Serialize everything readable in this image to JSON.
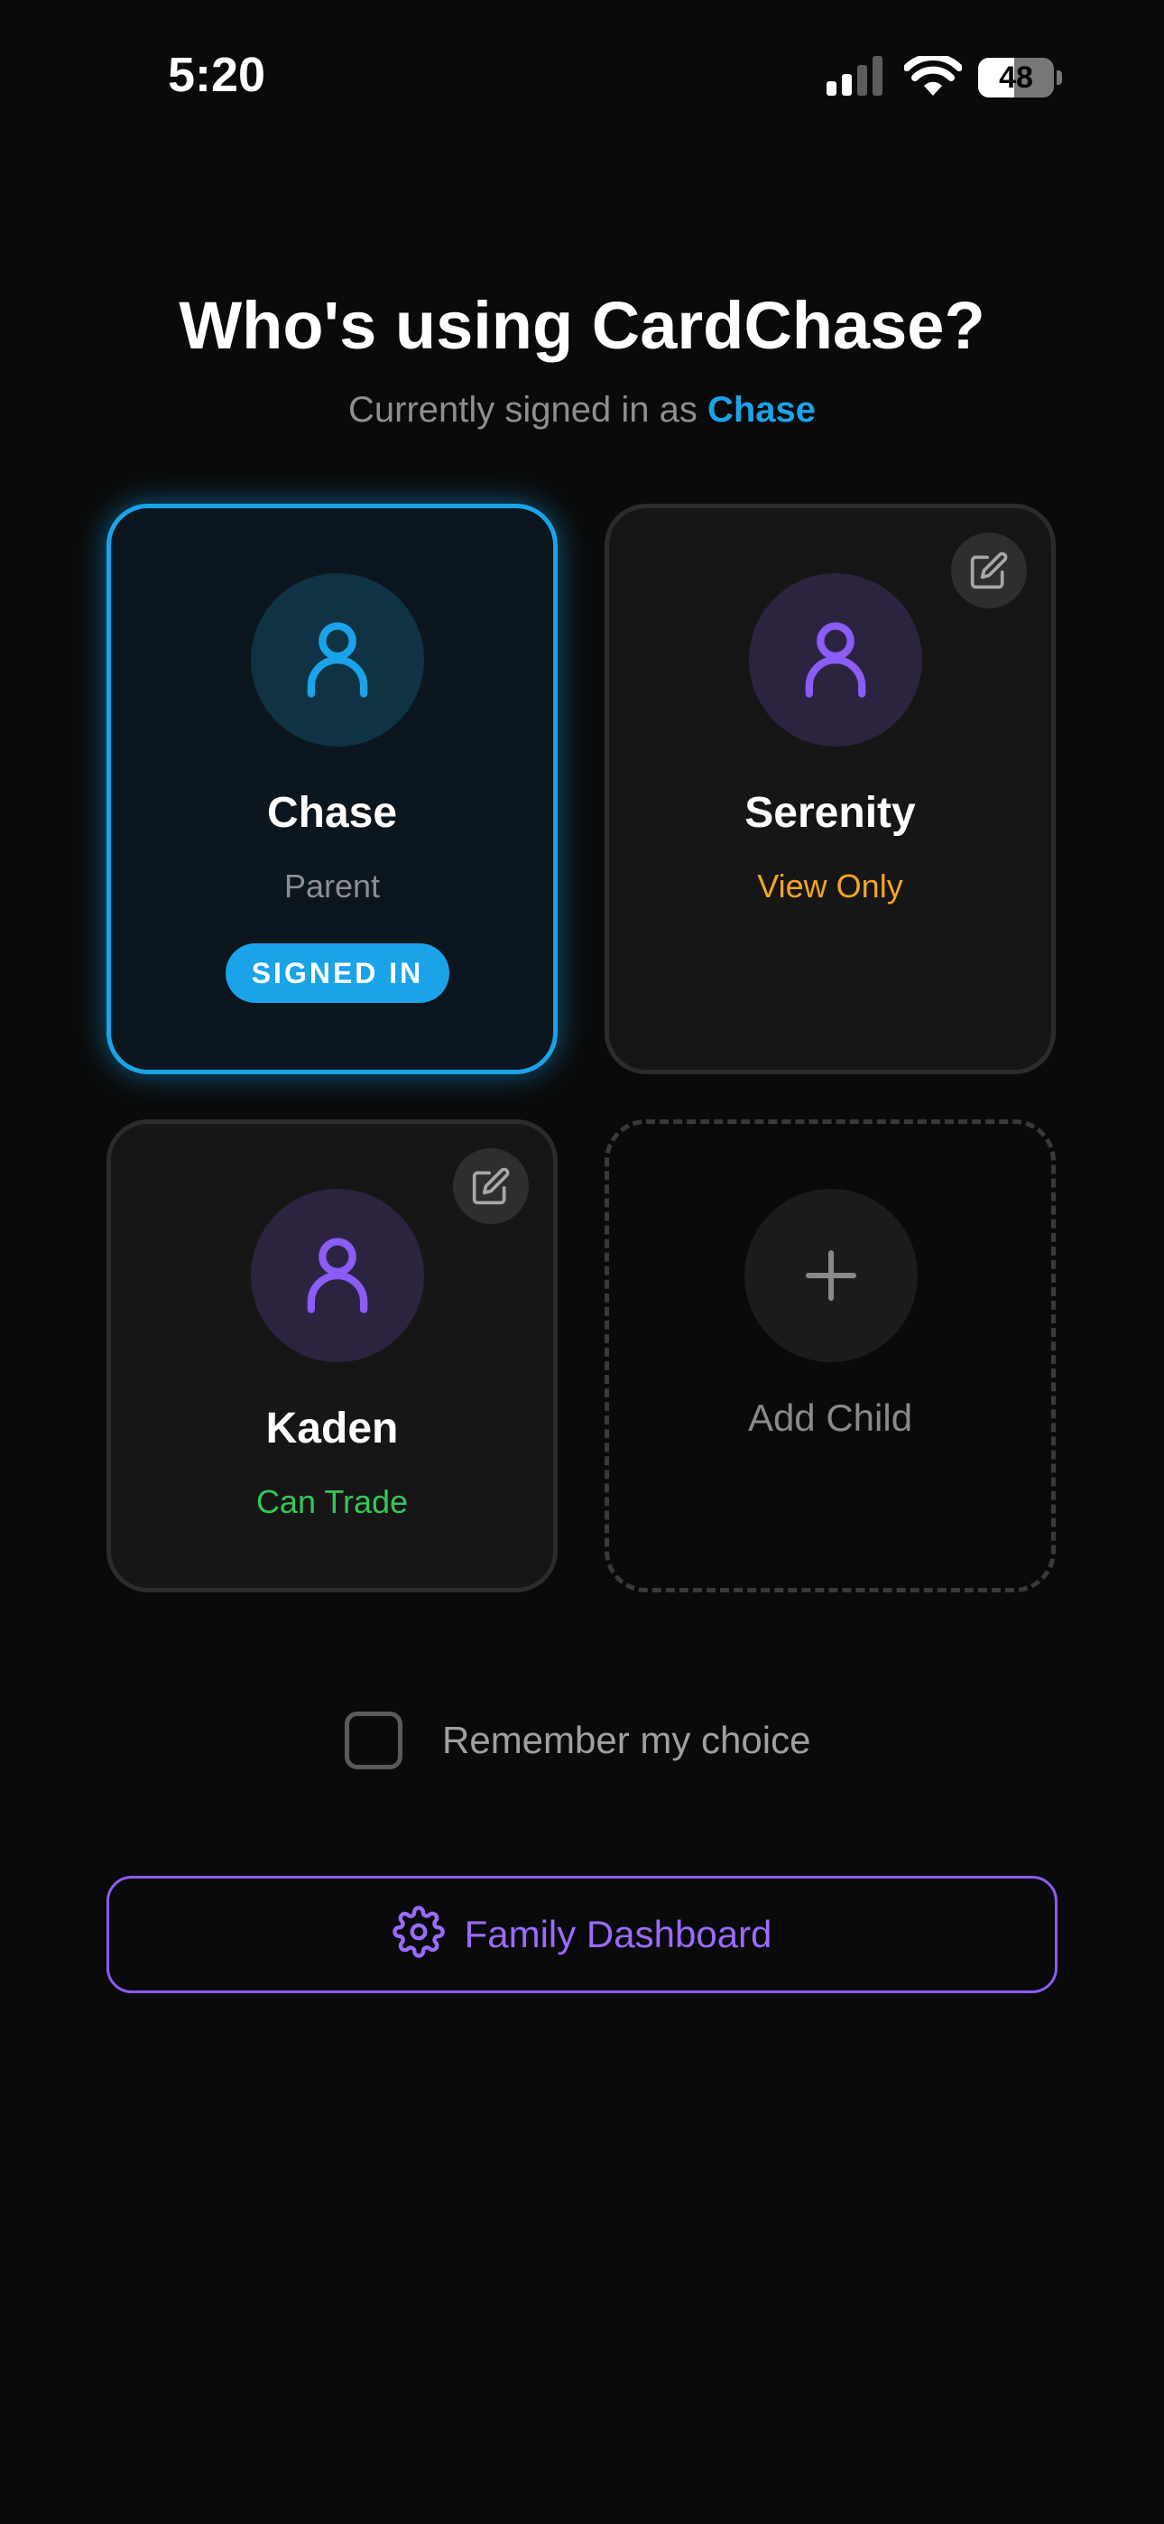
{
  "status_bar": {
    "time": "5:20",
    "battery": "48",
    "battery_level": 0.48
  },
  "header": {
    "title": "Who's using CardChase?",
    "subtitle_prefix": "Currently signed in as ",
    "subtitle_name": "Chase"
  },
  "profiles": [
    {
      "name": "Chase",
      "role": "Parent",
      "badge": "SIGNED IN",
      "role_color": "#8e8e93",
      "accent": "#1aa3e8",
      "avatar_bg": "#0f3345",
      "icon": "user-icon"
    },
    {
      "name": "Serenity",
      "role": "View Only",
      "role_color": "#f5a623",
      "accent": "#8b5cf6",
      "avatar_bg": "#2c2340",
      "icon": "user-icon"
    },
    {
      "name": "Kaden",
      "role": "Can Trade",
      "role_color": "#34c759",
      "accent": "#8b5cf6",
      "avatar_bg": "#2c2340",
      "icon": "user-icon"
    }
  ],
  "add_child": {
    "label": "Add Child",
    "icon": "plus-icon"
  },
  "remember": {
    "label": "Remember my choice",
    "checked": false
  },
  "dashboard_button": {
    "label": "Family Dashboard",
    "icon": "gear-icon",
    "color": "#8b5cf6"
  }
}
